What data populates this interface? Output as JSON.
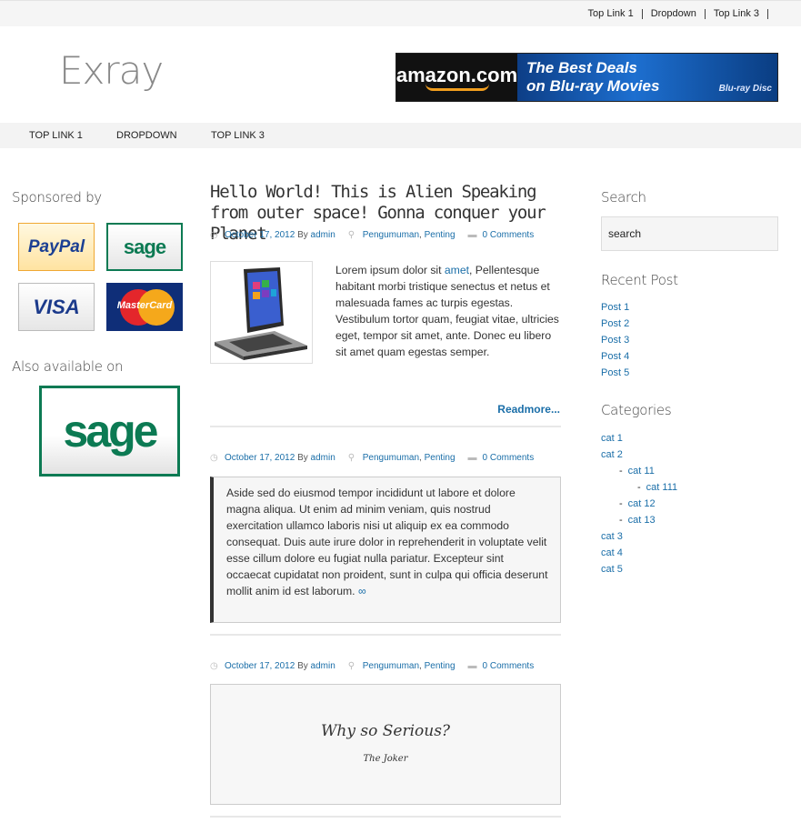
{
  "top_links": [
    "Top Link 1",
    "Dropdown",
    "Top Link 3"
  ],
  "logo": "Exray",
  "banner": {
    "brand": "amazon.com",
    "line1": "The Best Deals",
    "line2": "on Blu-ray Movies",
    "disc": "Blu-ray Disc"
  },
  "nav": [
    "TOP LINK 1",
    "DROPDOWN",
    "TOP LINK 3"
  ],
  "left_sidebar": {
    "sponsored_heading": "Sponsored by",
    "sponsors": [
      "PayPal",
      "sage",
      "VISA",
      "MasterCard"
    ],
    "also_heading": "Also available on",
    "also_logo": "sage"
  },
  "posts": [
    {
      "title": "Hello World! This is Alien Speaking from outer space! Gonna conquer your Planet",
      "date": "October 17, 2012",
      "by": "By",
      "author": "admin",
      "cat1": "Pengumuman",
      "cat2": "Penting",
      "comments": "0 Comments",
      "excerpt_pre": "Lorem ipsum dolor sit ",
      "excerpt_link": "amet",
      "excerpt_post": ", Pellentesque habitant morbi tristique senectus et netus et malesuada fames ac turpis egestas. Vestibulum tortor quam, feugiat vitae, ultricies eget, tempor sit amet, ante. Donec eu libero sit amet quam egestas semper.",
      "readmore": "Readmore..."
    },
    {
      "date": "October 17, 2012",
      "by": "By",
      "author": "admin",
      "cat1": "Pengumuman",
      "cat2": "Penting",
      "comments": "0 Comments",
      "aside": "Aside sed do eiusmod tempor incididunt ut labore et dolore magna aliqua. Ut enim ad minim veniam, quis nostrud exercitation ullamco laboris nisi ut aliquip ex ea commodo consequat. Duis aute irure dolor in reprehenderit in voluptate velit esse cillum dolore eu fugiat nulla pariatur. Excepteur sint occaecat cupidatat non proident, sunt in culpa qui officia deserunt mollit anim id est laborum.",
      "permalink": "∞"
    },
    {
      "date": "October 17, 2012",
      "by": "By",
      "author": "admin",
      "cat1": "Pengumuman",
      "cat2": "Penting",
      "comments": "0 Comments",
      "quote": "Why so Serious?",
      "quote_by": "The Joker"
    }
  ],
  "right_sidebar": {
    "search_heading": "Search",
    "search_value": "search",
    "recent_heading": "Recent Post",
    "recent": [
      "Post 1",
      "Post 2",
      "Post 3",
      "Post 4",
      "Post 5"
    ],
    "categories_heading": "Categories",
    "cat": [
      "cat 1",
      "cat 2",
      "cat 11",
      "cat 111",
      "cat 12",
      "cat 13",
      "cat 3",
      "cat 4",
      "cat 5"
    ]
  }
}
